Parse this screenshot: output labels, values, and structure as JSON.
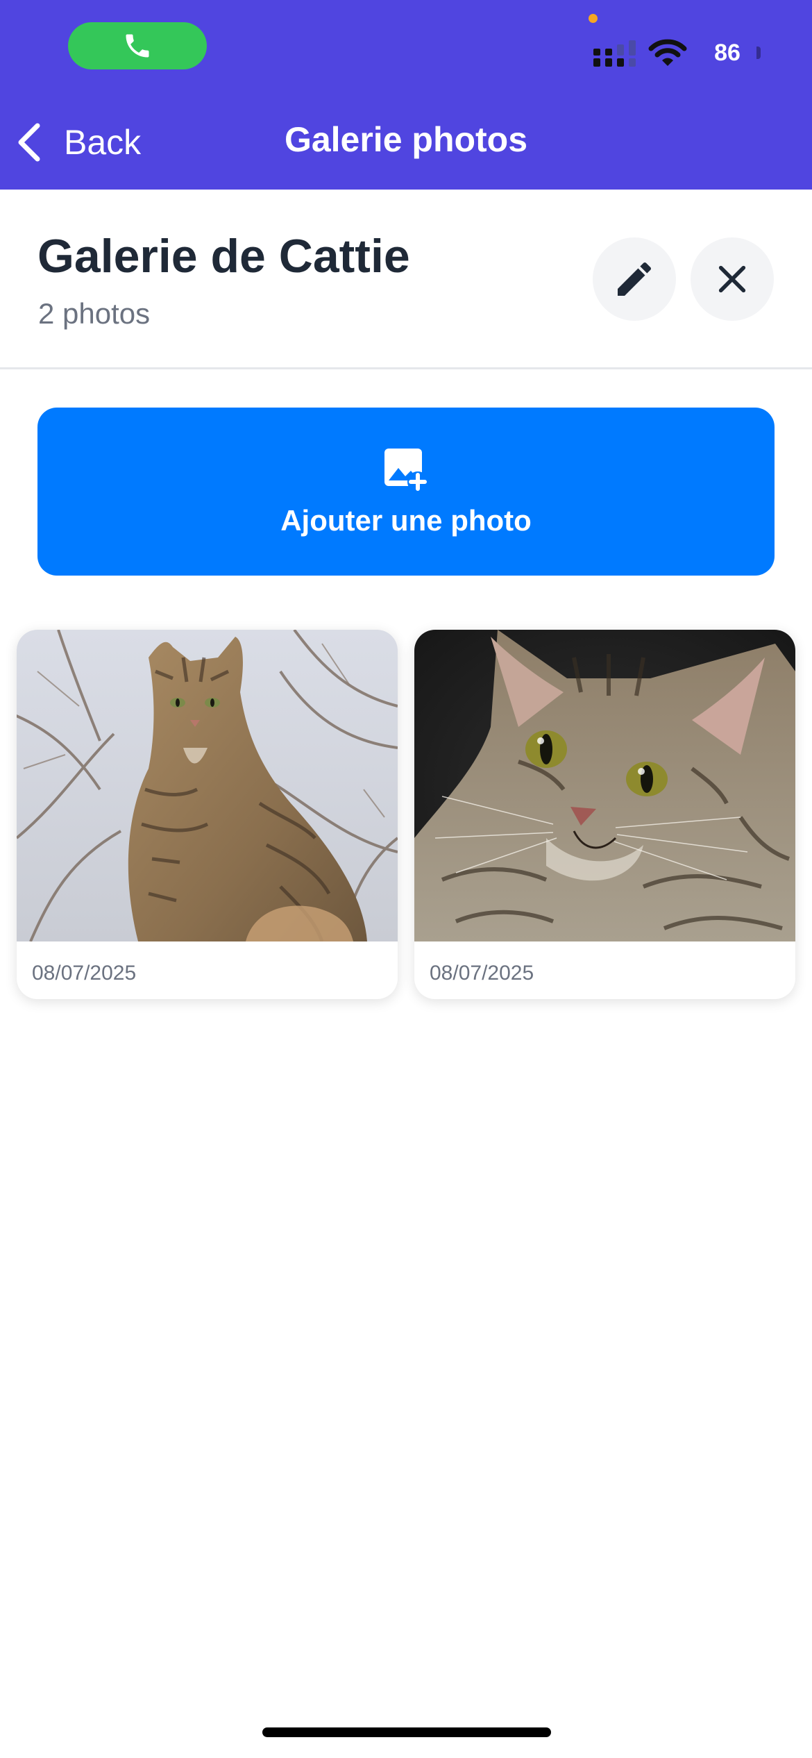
{
  "status_bar": {
    "battery": "86",
    "call_color": "#34C759",
    "privacy_dot_color": "#F5A623",
    "icons": [
      "phone-icon",
      "cellular-signal-icon",
      "wifi-icon",
      "battery-icon"
    ]
  },
  "nav": {
    "back_label": "Back",
    "title": "Galerie photos",
    "bar_color": "#5045E0"
  },
  "gallery": {
    "title": "Galerie de Cattie",
    "count_label": "2 photos",
    "actions": [
      "pencil-icon",
      "close-icon"
    ]
  },
  "add_button": {
    "label": "Ajouter une photo",
    "icon": "add-photo-icon",
    "color": "#007AFF"
  },
  "photos": [
    {
      "date": "08/07/2025",
      "subject": "tabby cat sitting among bare branches"
    },
    {
      "date": "08/07/2025",
      "subject": "tabby kitten close-up on dark background"
    }
  ]
}
